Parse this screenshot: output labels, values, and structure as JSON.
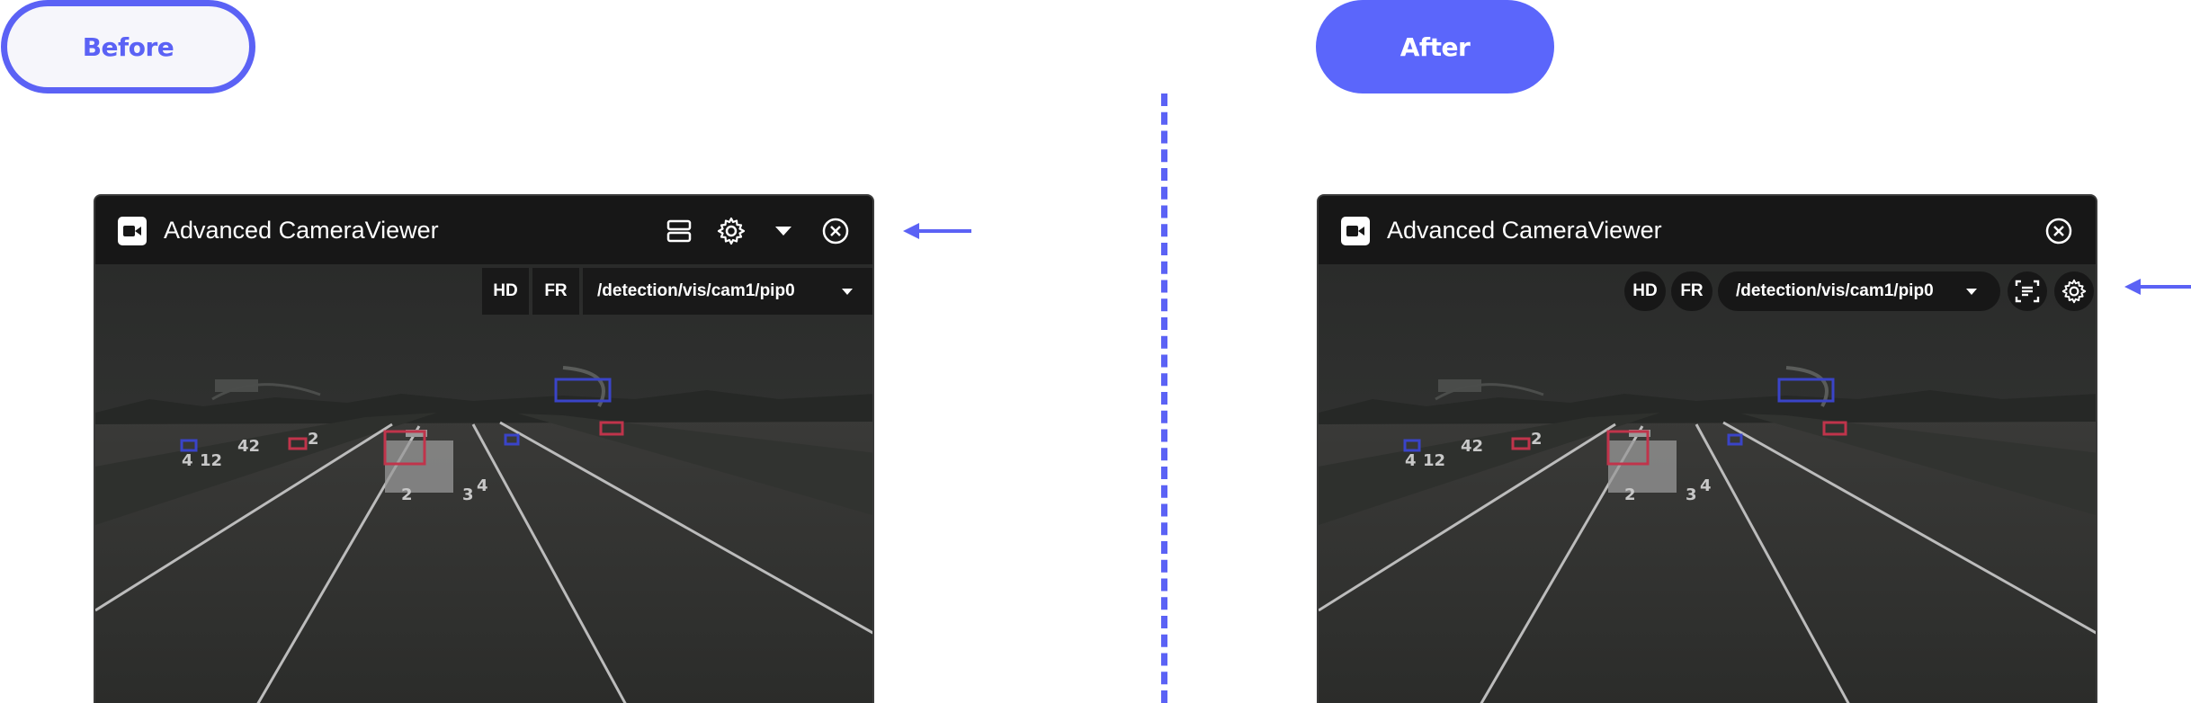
{
  "labels": {
    "before": "Before",
    "after": "After"
  },
  "window": {
    "title": "Advanced CameraViewer",
    "hd_label": "HD",
    "fr_label": "FR",
    "topic_value": "/detection/vis/cam1/pip0"
  },
  "detections": {
    "labels": [
      "4",
      "12",
      "42",
      "2",
      "2",
      "3",
      "4"
    ]
  },
  "icons": {
    "before_titlebar": [
      "video-camera-icon",
      "layout-stack-icon",
      "gear-icon",
      "caret-down-icon",
      "close-circle-icon"
    ],
    "after_titlebar": [
      "video-camera-icon",
      "close-circle-icon"
    ],
    "after_toolbar": [
      "caret-down-icon",
      "subtitles-icon",
      "gear-icon"
    ]
  },
  "colors": {
    "accent": "#5b62f5",
    "titlebar": "#171717",
    "box_blue": "#3a44c8",
    "box_red": "#c0344b"
  }
}
